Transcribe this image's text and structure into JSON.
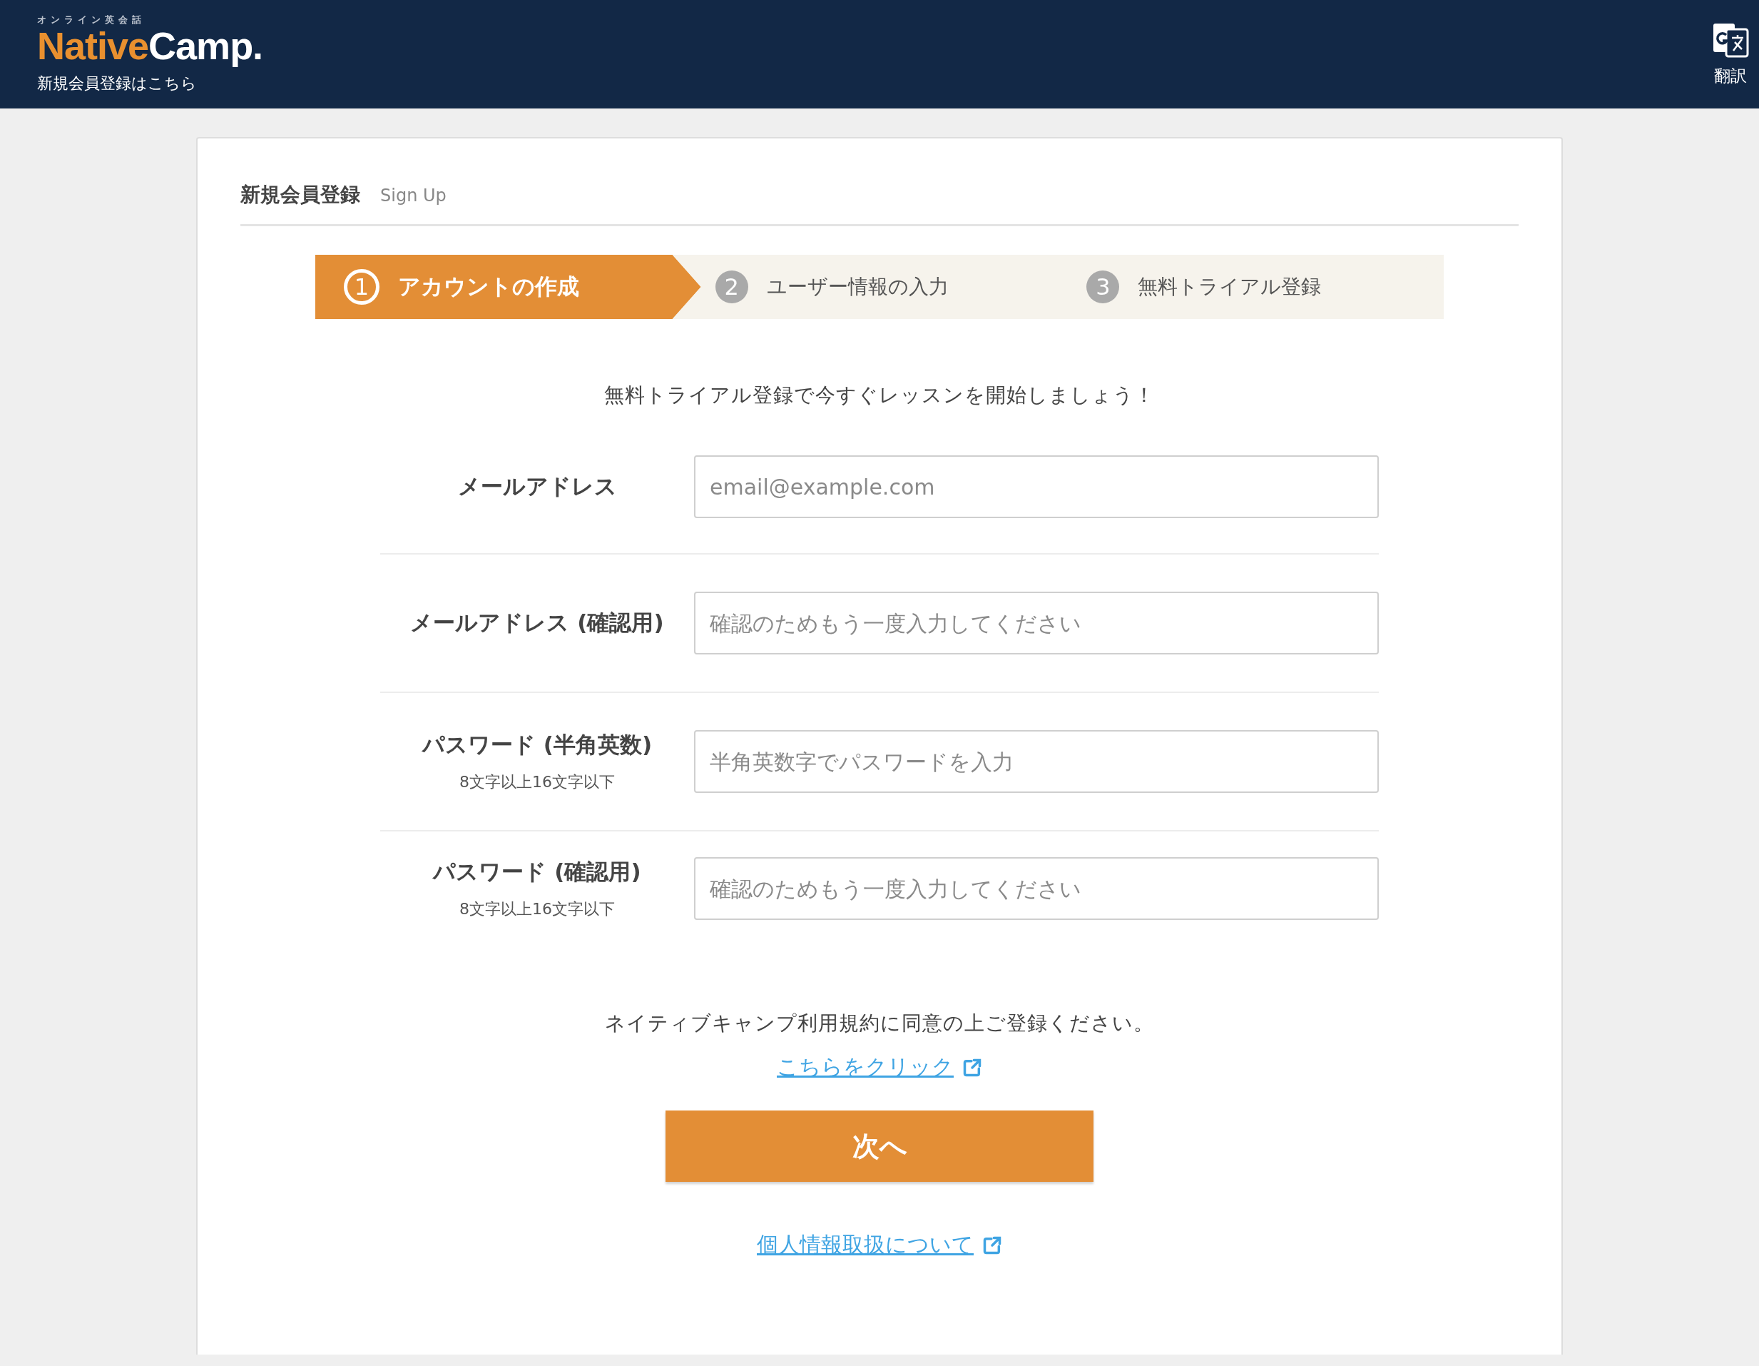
{
  "header": {
    "logo_tagline": "オンライン英会話",
    "logo_part_1": "Native",
    "logo_part_2": "Camp.",
    "subtitle": "新規会員登録はこちら",
    "translate_label": "翻訳"
  },
  "card": {
    "title": "新規会員登録",
    "subtitle": "Sign Up"
  },
  "steps": [
    {
      "number": "1",
      "label": "アカウントの作成",
      "selected": true
    },
    {
      "number": "2",
      "label": "ユーザー情報の入力",
      "selected": false
    },
    {
      "number": "3",
      "label": "無料トライアル登録",
      "selected": false
    }
  ],
  "intro": "無料トライアル登録で今すぐレッスンを開始しましょう！",
  "fields": [
    {
      "label": "メールアドレス",
      "placeholder": "email@example.com"
    },
    {
      "label": "メールアドレス (確認用)",
      "placeholder": "確認のためもう一度入力してください"
    },
    {
      "label": "パスワード (半角英数)",
      "note": "8文字以上16文字以下",
      "placeholder": "半角英数字でパスワードを入力"
    },
    {
      "label": "パスワード (確認用)",
      "note": "8文字以上16文字以下",
      "placeholder": "確認のためもう一度入力してください"
    }
  ],
  "terms_text": "ネイティブキャンプ利用規約に同意の上ご登録ください。",
  "terms_link": "こちらをクリック",
  "next_button": "次へ",
  "privacy_link": "個人情報取扱について"
}
